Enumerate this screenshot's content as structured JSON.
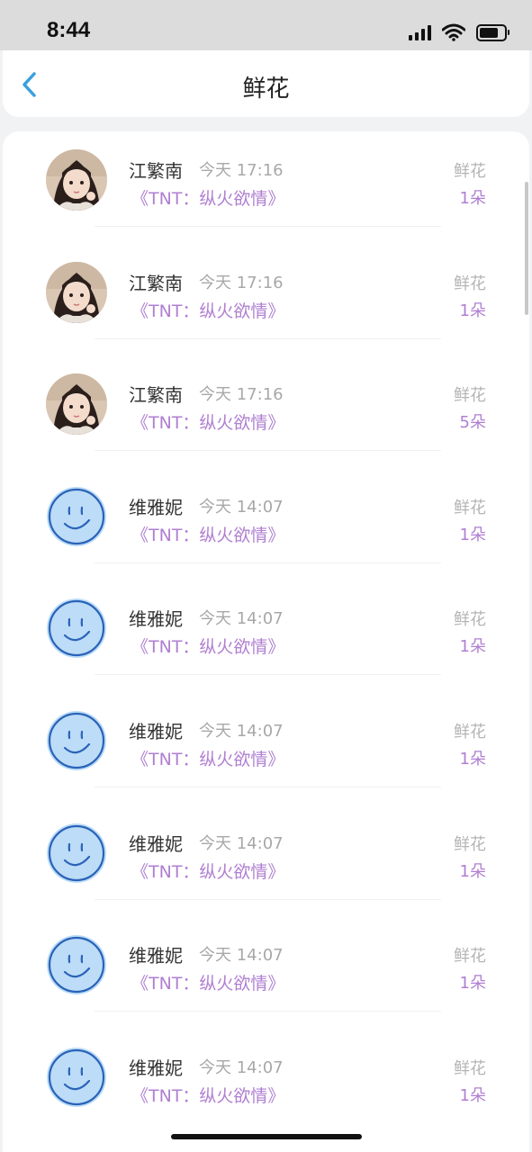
{
  "status_bar": {
    "time": "8:44"
  },
  "nav": {
    "title": "鲜花"
  },
  "rows": [
    {
      "avatar": "girl-photo-avatar",
      "name": "江繁南",
      "time": "今天 17:16",
      "book": "《TNT：纵火欲情》",
      "gift_label": "鲜花",
      "gift_count": "1朵"
    },
    {
      "avatar": "girl-photo-avatar",
      "name": "江繁南",
      "time": "今天 17:16",
      "book": "《TNT：纵火欲情》",
      "gift_label": "鲜花",
      "gift_count": "1朵"
    },
    {
      "avatar": "girl-photo-avatar",
      "name": "江繁南",
      "time": "今天 17:16",
      "book": "《TNT：纵火欲情》",
      "gift_label": "鲜花",
      "gift_count": "5朵"
    },
    {
      "avatar": "smiley-avatar",
      "name": "维雅妮",
      "time": "今天 14:07",
      "book": "《TNT：纵火欲情》",
      "gift_label": "鲜花",
      "gift_count": "1朵"
    },
    {
      "avatar": "smiley-avatar",
      "name": "维雅妮",
      "time": "今天 14:07",
      "book": "《TNT：纵火欲情》",
      "gift_label": "鲜花",
      "gift_count": "1朵"
    },
    {
      "avatar": "smiley-avatar",
      "name": "维雅妮",
      "time": "今天 14:07",
      "book": "《TNT：纵火欲情》",
      "gift_label": "鲜花",
      "gift_count": "1朵"
    },
    {
      "avatar": "smiley-avatar",
      "name": "维雅妮",
      "time": "今天 14:07",
      "book": "《TNT：纵火欲情》",
      "gift_label": "鲜花",
      "gift_count": "1朵"
    },
    {
      "avatar": "smiley-avatar",
      "name": "维雅妮",
      "time": "今天 14:07",
      "book": "《TNT：纵火欲情》",
      "gift_label": "鲜花",
      "gift_count": "1朵"
    },
    {
      "avatar": "smiley-avatar",
      "name": "维雅妮",
      "time": "今天 14:07",
      "book": "《TNT：纵火欲情》",
      "gift_label": "鲜花",
      "gift_count": "1朵"
    }
  ],
  "colors": {
    "accent": "#b07fd2",
    "back_arrow": "#3aa0e0",
    "smiley_fill": "#bcdcf7",
    "smiley_stroke": "#2a63b8"
  }
}
